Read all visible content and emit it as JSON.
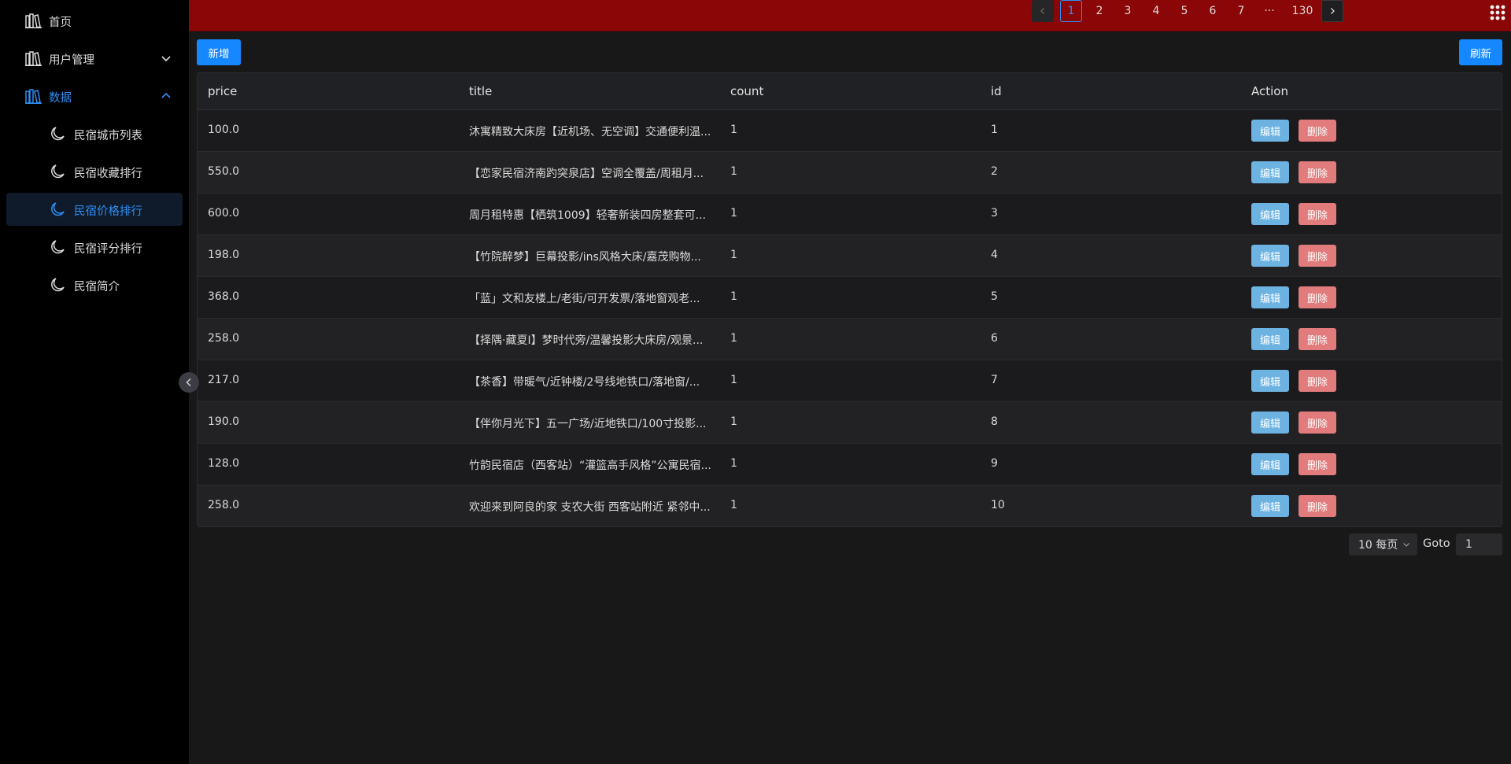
{
  "sidebar": {
    "items": [
      {
        "label": "首页",
        "icon": "library-icon"
      },
      {
        "label": "用户管理",
        "icon": "library-icon"
      },
      {
        "label": "数据",
        "icon": "library-icon"
      }
    ],
    "sub_items": [
      {
        "label": "民宿城市列表",
        "icon": "moon-icon"
      },
      {
        "label": "民宿收藏排行",
        "icon": "moon-icon"
      },
      {
        "label": "民宿价格排行",
        "icon": "moon-icon"
      },
      {
        "label": "民宿评分排行",
        "icon": "moon-icon"
      },
      {
        "label": "民宿简介",
        "icon": "moon-icon"
      }
    ],
    "active_sub_item": "民宿价格排行"
  },
  "toolbar": {
    "add_label": "新增",
    "refresh_label": "刷新"
  },
  "table": {
    "columns": [
      "price",
      "title",
      "count",
      "id",
      "Action"
    ],
    "edit_label": "编辑",
    "delete_label": "删除",
    "rows": [
      {
        "price": "100.0",
        "title": "沐寓精致大床房【近机场、无空调】交通便利温...",
        "count": "1",
        "id": "1"
      },
      {
        "price": "550.0",
        "title": "【恋家民宿济南趵突泉店】空调全覆盖/周租月...",
        "count": "1",
        "id": "2"
      },
      {
        "price": "600.0",
        "title": "周月租特惠【栖筑1009】轻奢新装四房整套可...",
        "count": "1",
        "id": "3"
      },
      {
        "price": "198.0",
        "title": "【竹院醉梦】巨幕投影/ins风格大床/嘉茂购物...",
        "count": "1",
        "id": "4"
      },
      {
        "price": "368.0",
        "title": "「蓝」文和友楼上/老街/可开发票/落地窗观老...",
        "count": "1",
        "id": "5"
      },
      {
        "price": "258.0",
        "title": "【择隅·藏夏Ⅰ】梦时代旁/温馨投影大床房/观景...",
        "count": "1",
        "id": "6"
      },
      {
        "price": "217.0",
        "title": "【茶香】带暖气/近钟楼/2号线地铁口/落地窗/...",
        "count": "1",
        "id": "7"
      },
      {
        "price": "190.0",
        "title": "【伴你月光下】五一广场/近地铁口/100寸投影...",
        "count": "1",
        "id": "8"
      },
      {
        "price": "128.0",
        "title": "竹韵民宿店（西客站）“灌篮高手风格”公寓民宿...",
        "count": "1",
        "id": "9"
      },
      {
        "price": "258.0",
        "title": "欢迎来到阿良的家 支农大街 西客站附近 紧邻中...",
        "count": "1",
        "id": "10"
      }
    ]
  },
  "pagination": {
    "pages": [
      "1",
      "2",
      "3",
      "4",
      "5",
      "6",
      "7",
      "···",
      "130"
    ],
    "current_page": "1",
    "page_size_label": "10 每页",
    "goto_label": "Goto",
    "goto_value": "1"
  },
  "colors": {
    "header": "#8b0606",
    "accent": "#2f8ff5",
    "primary_button": "#1688ff",
    "edit_button": "#6cb3e2",
    "delete_button": "#e27b7b"
  }
}
